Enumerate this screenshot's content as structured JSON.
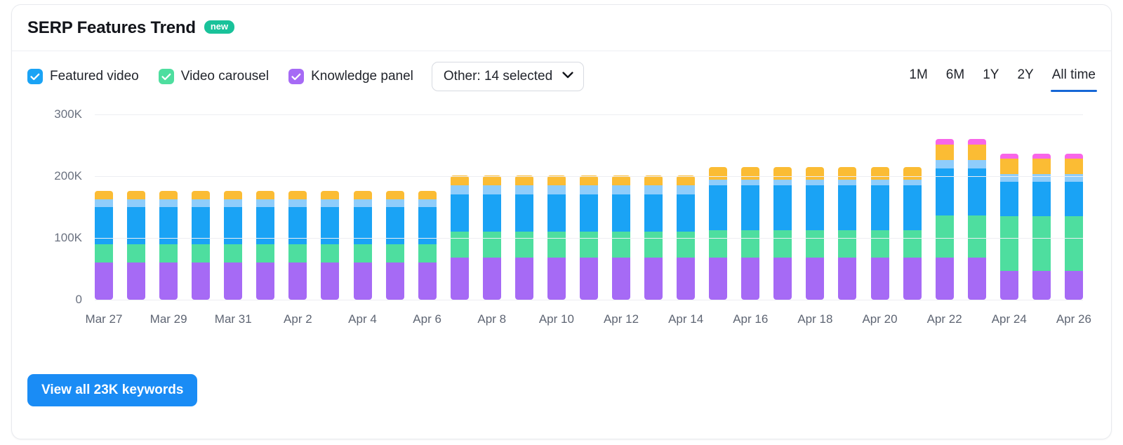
{
  "card": {
    "title": "SERP Features Trend",
    "badge": "new"
  },
  "legend": [
    {
      "label": "Featured video",
      "color": "#1aa3f5",
      "checked": true,
      "icon": "check-icon"
    },
    {
      "label": "Video carousel",
      "color": "#4ede9f",
      "checked": true,
      "icon": "check-icon"
    },
    {
      "label": "Knowledge panel",
      "color": "#a66af5",
      "checked": true,
      "icon": "check-icon"
    }
  ],
  "dropdown": {
    "label": "Other: 14 selected",
    "icon": "chevron-down-icon"
  },
  "ranges": [
    {
      "label": "1M",
      "active": false
    },
    {
      "label": "6M",
      "active": false
    },
    {
      "label": "1Y",
      "active": false
    },
    {
      "label": "2Y",
      "active": false
    },
    {
      "label": "All time",
      "active": true
    }
  ],
  "footer": {
    "cta_label": "View all 23K keywords"
  },
  "colors": {
    "accent": "#1a8cf5",
    "active_underline": "#1667d6",
    "badge": "#19c29a",
    "grid": "#edeef2"
  },
  "chart_data": {
    "type": "bar",
    "stacked": true,
    "title": "SERP Features Trend",
    "xlabel": "",
    "ylabel": "",
    "ylim": [
      0,
      300000
    ],
    "yticks": [
      "0",
      "100K",
      "200K",
      "300K"
    ],
    "ytick_values": [
      0,
      100000,
      200000,
      300000
    ],
    "grid": true,
    "legend_position": "top-left",
    "categories": [
      "Mar 27",
      "Mar 28",
      "Mar 29",
      "Mar 30",
      "Mar 31",
      "Apr 1",
      "Apr 2",
      "Apr 3",
      "Apr 4",
      "Apr 5",
      "Apr 6",
      "Apr 7",
      "Apr 8",
      "Apr 9",
      "Apr 10",
      "Apr 11",
      "Apr 12",
      "Apr 13",
      "Apr 14",
      "Apr 15",
      "Apr 16",
      "Apr 17",
      "Apr 18",
      "Apr 19",
      "Apr 20",
      "Apr 21",
      "Apr 22",
      "Apr 23",
      "Apr 24",
      "Apr 25",
      "Apr 26"
    ],
    "tick_labels": [
      "Mar 27",
      "",
      "Mar 29",
      "",
      "Mar 31",
      "",
      "Apr 2",
      "",
      "Apr 4",
      "",
      "Apr 6",
      "",
      "Apr 8",
      "",
      "Apr 10",
      "",
      "Apr 12",
      "",
      "Apr 14",
      "",
      "Apr 16",
      "",
      "Apr 18",
      "",
      "Apr 20",
      "",
      "Apr 22",
      "",
      "Apr 24",
      "",
      "Apr 26"
    ],
    "series": [
      {
        "name": "Knowledge panel",
        "color": "#a66af5",
        "values": [
          60000,
          60000,
          60000,
          60000,
          60000,
          60000,
          60000,
          60000,
          60000,
          60000,
          60000,
          68000,
          68000,
          68000,
          68000,
          68000,
          68000,
          68000,
          68000,
          68000,
          68000,
          68000,
          68000,
          68000,
          68000,
          68000,
          68000,
          68000,
          47000,
          47000,
          47000
        ]
      },
      {
        "name": "Video carousel",
        "color": "#4ede9f",
        "values": [
          30000,
          30000,
          30000,
          30000,
          30000,
          30000,
          30000,
          30000,
          30000,
          30000,
          30000,
          42000,
          42000,
          42000,
          42000,
          42000,
          42000,
          42000,
          42000,
          44000,
          44000,
          44000,
          44000,
          44000,
          44000,
          44000,
          68000,
          68000,
          88000,
          88000,
          88000
        ]
      },
      {
        "name": "Featured video",
        "color": "#1aa3f5",
        "color_light": "#8fcdfb",
        "values": [
          60000,
          60000,
          60000,
          60000,
          60000,
          60000,
          60000,
          60000,
          60000,
          60000,
          60000,
          60000,
          60000,
          60000,
          60000,
          60000,
          60000,
          60000,
          60000,
          73000,
          73000,
          73000,
          73000,
          73000,
          73000,
          73000,
          76000,
          76000,
          56000,
          56000,
          56000
        ]
      },
      {
        "name": "Other (light blue)",
        "color": "#8fcdfb",
        "values": [
          13000,
          13000,
          13000,
          13000,
          13000,
          13000,
          13000,
          13000,
          13000,
          13000,
          13000,
          15000,
          15000,
          15000,
          15000,
          15000,
          15000,
          15000,
          15000,
          9000,
          9000,
          9000,
          9000,
          9000,
          9000,
          9000,
          14000,
          14000,
          13000,
          13000,
          13000
        ]
      },
      {
        "name": "Other (orange)",
        "color": "#fbbc34",
        "values": [
          13000,
          13000,
          13000,
          13000,
          13000,
          13000,
          13000,
          13000,
          13000,
          13000,
          13000,
          16000,
          16000,
          16000,
          16000,
          16000,
          16000,
          16000,
          16000,
          21000,
          21000,
          21000,
          21000,
          21000,
          21000,
          21000,
          25000,
          25000,
          24000,
          24000,
          24000
        ]
      },
      {
        "name": "Other (pink)",
        "color": "#f866e8",
        "values": [
          0,
          0,
          0,
          0,
          0,
          0,
          0,
          0,
          0,
          0,
          0,
          0,
          0,
          0,
          0,
          0,
          0,
          0,
          0,
          0,
          0,
          0,
          0,
          0,
          0,
          0,
          9000,
          9000,
          8000,
          8000,
          8000
        ]
      }
    ],
    "totals": [
      176000,
      176000,
      176000,
      176000,
      176000,
      176000,
      176000,
      176000,
      176000,
      176000,
      176000,
      201000,
      201000,
      201000,
      201000,
      201000,
      201000,
      201000,
      201000,
      215000,
      215000,
      215000,
      215000,
      215000,
      215000,
      215000,
      260000,
      260000,
      236000,
      236000,
      236000
    ]
  }
}
